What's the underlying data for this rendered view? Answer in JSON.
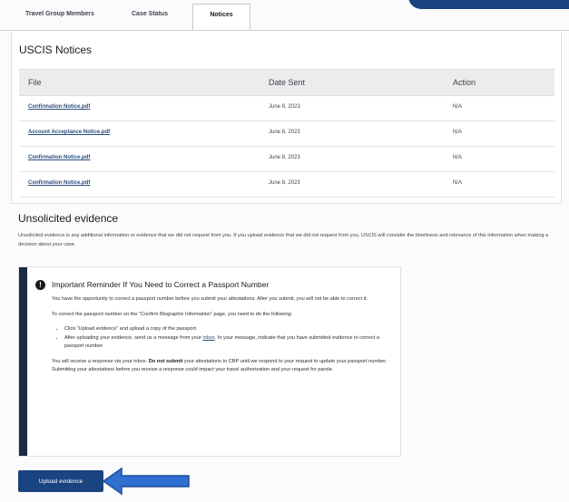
{
  "tabs": [
    {
      "label": "Travel Group Members",
      "active": false
    },
    {
      "label": "Case Status",
      "active": false
    },
    {
      "label": "Notices",
      "active": true
    }
  ],
  "notices": {
    "title": "USCIS Notices",
    "columns": {
      "file": "File",
      "date": "Date Sent",
      "action": "Action"
    },
    "rows": [
      {
        "file": "Confirmation Notice.pdf",
        "date": "June 8, 2023",
        "action": "N/A"
      },
      {
        "file": "Account Acceptance Notice.pdf",
        "date": "June 8, 2023",
        "action": "N/A"
      },
      {
        "file": "Confirmation Notice.pdf",
        "date": "June 8, 2023",
        "action": "N/A"
      },
      {
        "file": "Confirmation Notice.pdf",
        "date": "June 8, 2023",
        "action": "N/A"
      }
    ]
  },
  "unsolicited": {
    "title": "Unsolicited evidence",
    "description": "Unsolicited evidence is any additional information or evidence that we did not request from you. If you upload evidence that we did not request from you, USCIS will consider the timeliness and relevance of this information when making a decision about your case."
  },
  "reminder": {
    "icon": "info-icon",
    "heading": "Important Reminder If You Need to Correct a Passport Number",
    "para1": "You have the opportunity to correct a passport number before you submit your attestations. After you submit, you will not be able to correct it.",
    "para2": "To correct the passport number on the “Confirm Biographic Information” page, you need to do the following:",
    "bullet1": "Click “Upload evidence” and upload a copy of the passport.",
    "bullet2_before": "After uploading your evidence, send us a message from your ",
    "bullet2_link": "inbox",
    "bullet2_after": ". In your message, indicate that you have submitted evidence to correct a passport number.",
    "para3_before": "You will receive a response via your inbox. ",
    "para3_bold": "Do not submit",
    "para3_after": " your attestations to CBP until we respond to your request to update your passport number. Submitting your attestations before you receive a response could impact your travel authorization and your request for parole."
  },
  "upload_button": {
    "label": "Upload evidence"
  },
  "colors": {
    "primary": "#1a4480",
    "alert_bar": "#1b2a44",
    "arrow": "#2f6fd0"
  }
}
